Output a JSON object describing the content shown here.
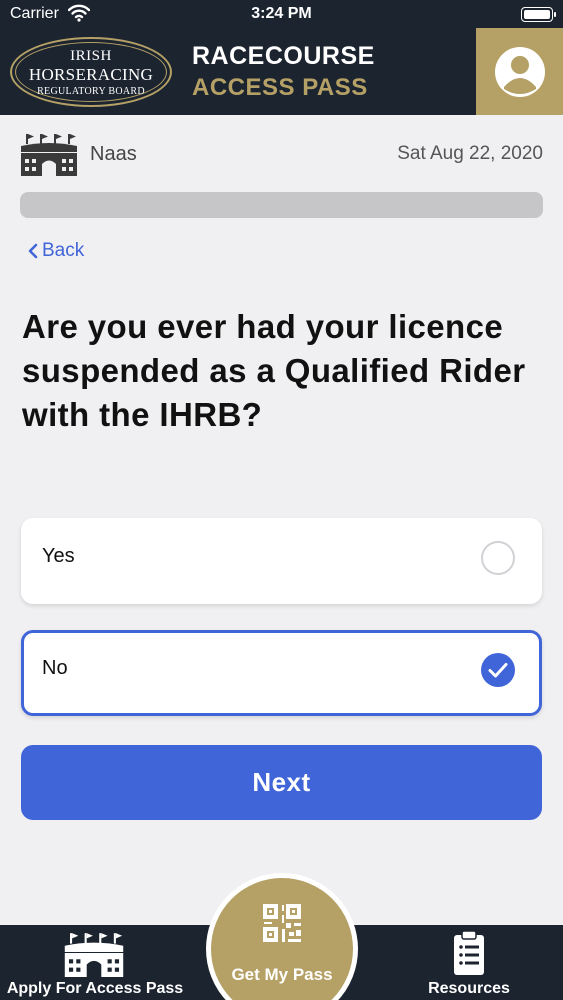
{
  "status_bar": {
    "carrier": "Carrier",
    "time": "3:24 PM"
  },
  "header": {
    "logo_line1": "IRISH",
    "logo_line2": "HORSERACING",
    "logo_line3": "REGULATORY BOARD",
    "title": "RACECOURSE",
    "subtitle": "ACCESS PASS",
    "profile_icon": "user-avatar-icon"
  },
  "venue": {
    "name": "Naas",
    "date": "Sat Aug 22, 2020",
    "icon": "racecourse-stand-icon"
  },
  "progress": {
    "fraction": 0.0
  },
  "nav": {
    "back_label": "Back"
  },
  "question": {
    "text": "Are you ever had your licence suspended as a Qualified Rider with the IHRB?"
  },
  "options": [
    {
      "label": "Yes",
      "selected": false
    },
    {
      "label": "No",
      "selected": true
    }
  ],
  "next_button": {
    "label": "Next"
  },
  "tab_bar": {
    "items": [
      {
        "label": "Apply For Access Pass",
        "icon": "racecourse-stand-icon"
      },
      {
        "label": "Get My Pass",
        "icon": "qr-code-icon"
      },
      {
        "label": "Resources",
        "icon": "clipboard-list-icon"
      }
    ]
  },
  "colors": {
    "navy": "#1c2430",
    "gold": "#b5a066",
    "accent_blue": "#4065d8",
    "background": "#f0f0f2"
  }
}
